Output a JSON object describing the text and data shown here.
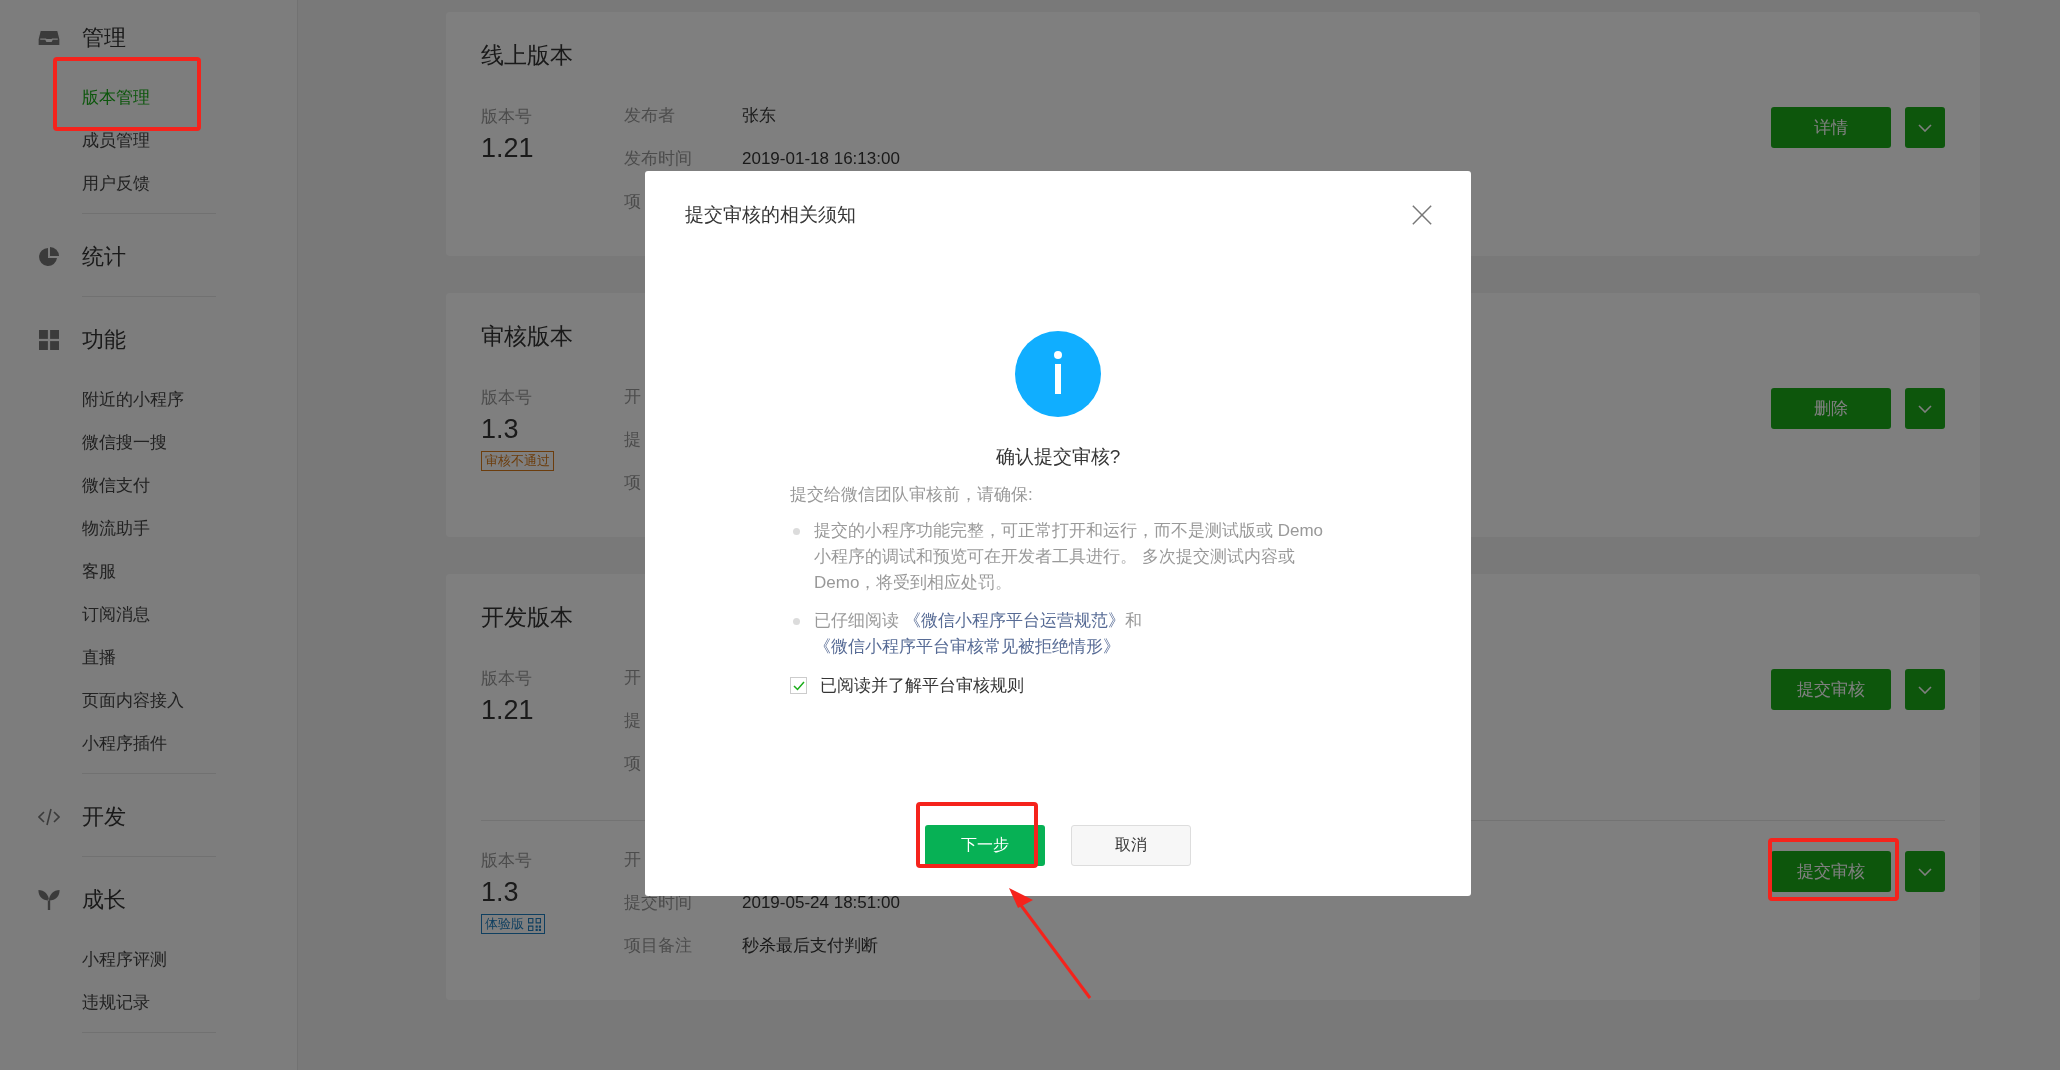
{
  "sidebar": {
    "groups": [
      {
        "title": "管理",
        "items": [
          {
            "label": "版本管理",
            "selected": true
          },
          {
            "label": "成员管理",
            "selected": false
          },
          {
            "label": "用户反馈",
            "selected": false
          }
        ]
      },
      {
        "title": "统计"
      },
      {
        "title": "功能",
        "items": [
          {
            "label": "附近的小程序",
            "selected": false
          },
          {
            "label": "微信搜一搜",
            "selected": false
          },
          {
            "label": "微信支付",
            "selected": false
          },
          {
            "label": "物流助手",
            "selected": false
          },
          {
            "label": "客服",
            "selected": false
          },
          {
            "label": "订阅消息",
            "selected": false
          },
          {
            "label": "直播",
            "selected": false
          },
          {
            "label": "页面内容接入",
            "selected": false
          },
          {
            "label": "小程序插件",
            "selected": false
          }
        ]
      },
      {
        "title": "开发"
      },
      {
        "title": "成长",
        "items": [
          {
            "label": "小程序评测",
            "selected": false
          },
          {
            "label": "违规记录",
            "selected": false
          }
        ]
      }
    ]
  },
  "cards": [
    {
      "title": "线上版本",
      "entries": [
        {
          "version_label": "版本号",
          "version": "1.21",
          "meta": [
            {
              "label": "发布者",
              "value": "张东"
            },
            {
              "label": "发布时间",
              "value": "2019-01-18 16:13:00"
            },
            {
              "label": "项"
            }
          ],
          "action": "详情"
        }
      ]
    },
    {
      "title": "审核版本",
      "entries": [
        {
          "version_label": "版本号",
          "version": "1.3",
          "tag": {
            "text": "审核不通过",
            "kind": "rejected"
          },
          "meta": [
            {
              "label": "开"
            },
            {
              "label": "提"
            },
            {
              "label": "项"
            }
          ],
          "action": "删除"
        }
      ]
    },
    {
      "title": "开发版本",
      "entries": [
        {
          "version_label": "版本号",
          "version": "1.21",
          "meta": [
            {
              "label": "开"
            },
            {
              "label": "提"
            },
            {
              "label": "项"
            }
          ],
          "action": "提交审核"
        },
        {
          "version_label": "版本号",
          "version": "1.3",
          "tag": {
            "text": "体验版",
            "kind": "trial"
          },
          "meta": [
            {
              "label": "开"
            },
            {
              "label": "提交时间",
              "value": "2019-05-24 18:51:00"
            },
            {
              "label": "项目备注",
              "value": "秒杀最后支付判断"
            }
          ],
          "action": "提交审核"
        }
      ]
    }
  ],
  "dialog": {
    "title": "提交审核的相关须知",
    "heading": "确认提交审核?",
    "intro": "提交给微信团队审核前，请确保:",
    "bullets": [
      [
        {
          "text": "提交的小程序功能完整，可正常打开和运行，而不是测试版或 Demo 小程序的调试和预览可在开发者工具进行。 多次提交测试内容或 Demo，将受到相应处罚。",
          "kind": "text"
        }
      ],
      [
        {
          "text": "已仔细阅读 ",
          "kind": "text"
        },
        {
          "text": "《微信小程序平台运营规范》",
          "kind": "link"
        },
        {
          "text": "和 ",
          "kind": "text"
        },
        {
          "text": "《微信小程序平台审核常见被拒绝情形》",
          "kind": "link"
        }
      ]
    ],
    "agree": {
      "label": "已阅读并了解平台审核规则",
      "checked": true
    },
    "buttons": [
      {
        "label": "下一步",
        "kind": "primary"
      },
      {
        "label": "取消",
        "kind": "default"
      }
    ]
  }
}
